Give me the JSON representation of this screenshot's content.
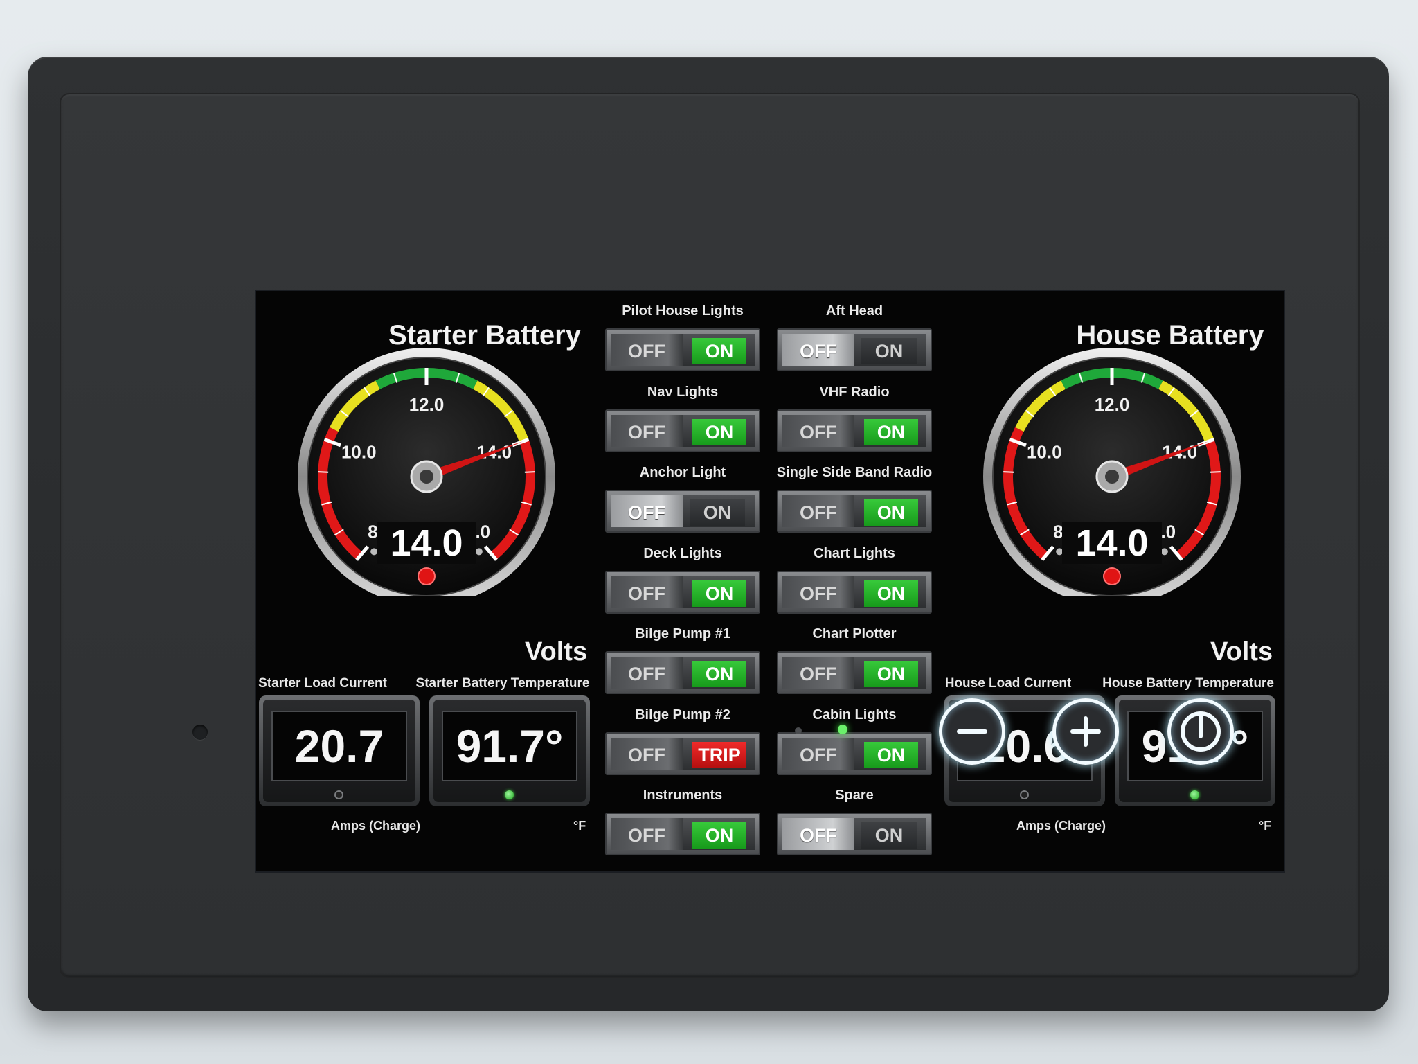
{
  "left_panel": {
    "title": "Starter Battery",
    "gauge": {
      "min": 8.0,
      "max": 16.0,
      "value": 14.0,
      "value_text": "14.0",
      "tick_labels": [
        "8.0",
        "10.0",
        "12.0",
        "14.0",
        "16.0"
      ],
      "unit_text": "Volts",
      "zone_colors": {
        "low": "#e01818",
        "mid": "#e7e020",
        "ok": "#1fa83a"
      }
    },
    "readouts": [
      {
        "label": "Starter Load Current",
        "value": "20.7",
        "unit": "Amps (Charge)",
        "led": "off"
      },
      {
        "label": "Starter Battery Temperature",
        "value": "91.7°",
        "unit": "°F",
        "led": "green"
      }
    ]
  },
  "right_panel": {
    "title": "House Battery",
    "gauge": {
      "min": 8.0,
      "max": 16.0,
      "value": 14.0,
      "value_text": "14.0",
      "tick_labels": [
        "8.0",
        "10.0",
        "12.0",
        "14.0",
        "16.0"
      ],
      "unit_text": "Volts",
      "zone_colors": {
        "low": "#e01818",
        "mid": "#e7e020",
        "ok": "#1fa83a"
      }
    },
    "readouts": [
      {
        "label": "House Load Current",
        "value": "20.6",
        "unit": "Amps (Charge)",
        "led": "off"
      },
      {
        "label": "House Battery Temperature",
        "value": "91.7°",
        "unit": "°F",
        "led": "green"
      }
    ]
  },
  "switches": [
    {
      "label": "Pilot House Lights",
      "off": "OFF",
      "on": "ON",
      "state": "on"
    },
    {
      "label": "Aft Head",
      "off": "OFF",
      "on": "ON",
      "state": "off"
    },
    {
      "label": "Nav Lights",
      "off": "OFF",
      "on": "ON",
      "state": "on"
    },
    {
      "label": "VHF Radio",
      "off": "OFF",
      "on": "ON",
      "state": "on"
    },
    {
      "label": "Anchor Light",
      "off": "OFF",
      "on": "ON",
      "state": "off"
    },
    {
      "label": "Single Side Band Radio",
      "off": "OFF",
      "on": "ON",
      "state": "on"
    },
    {
      "label": "Deck Lights",
      "off": "OFF",
      "on": "ON",
      "state": "on"
    },
    {
      "label": "Chart Lights",
      "off": "OFF",
      "on": "ON",
      "state": "on"
    },
    {
      "label": "Bilge Pump #1",
      "off": "OFF",
      "on": "ON",
      "state": "on"
    },
    {
      "label": "Chart Plotter",
      "off": "OFF",
      "on": "ON",
      "state": "on"
    },
    {
      "label": "Bilge Pump #2",
      "off": "OFF",
      "on": "TRIP",
      "state": "trip"
    },
    {
      "label": "Cabin Lights",
      "off": "OFF",
      "on": "ON",
      "state": "on"
    },
    {
      "label": "Instruments",
      "off": "OFF",
      "on": "ON",
      "state": "on"
    },
    {
      "label": "Spare",
      "off": "OFF",
      "on": "ON",
      "state": "off"
    }
  ],
  "hardware_buttons": [
    {
      "name": "minus",
      "icon": "minus-icon"
    },
    {
      "name": "plus",
      "icon": "plus-icon"
    },
    {
      "name": "power",
      "icon": "power-icon"
    }
  ],
  "colors": {
    "switch_on": "#22b326",
    "switch_trip": "#d81a1a",
    "status_led": "#3dd63d",
    "button_glow": "#bfeeff"
  }
}
